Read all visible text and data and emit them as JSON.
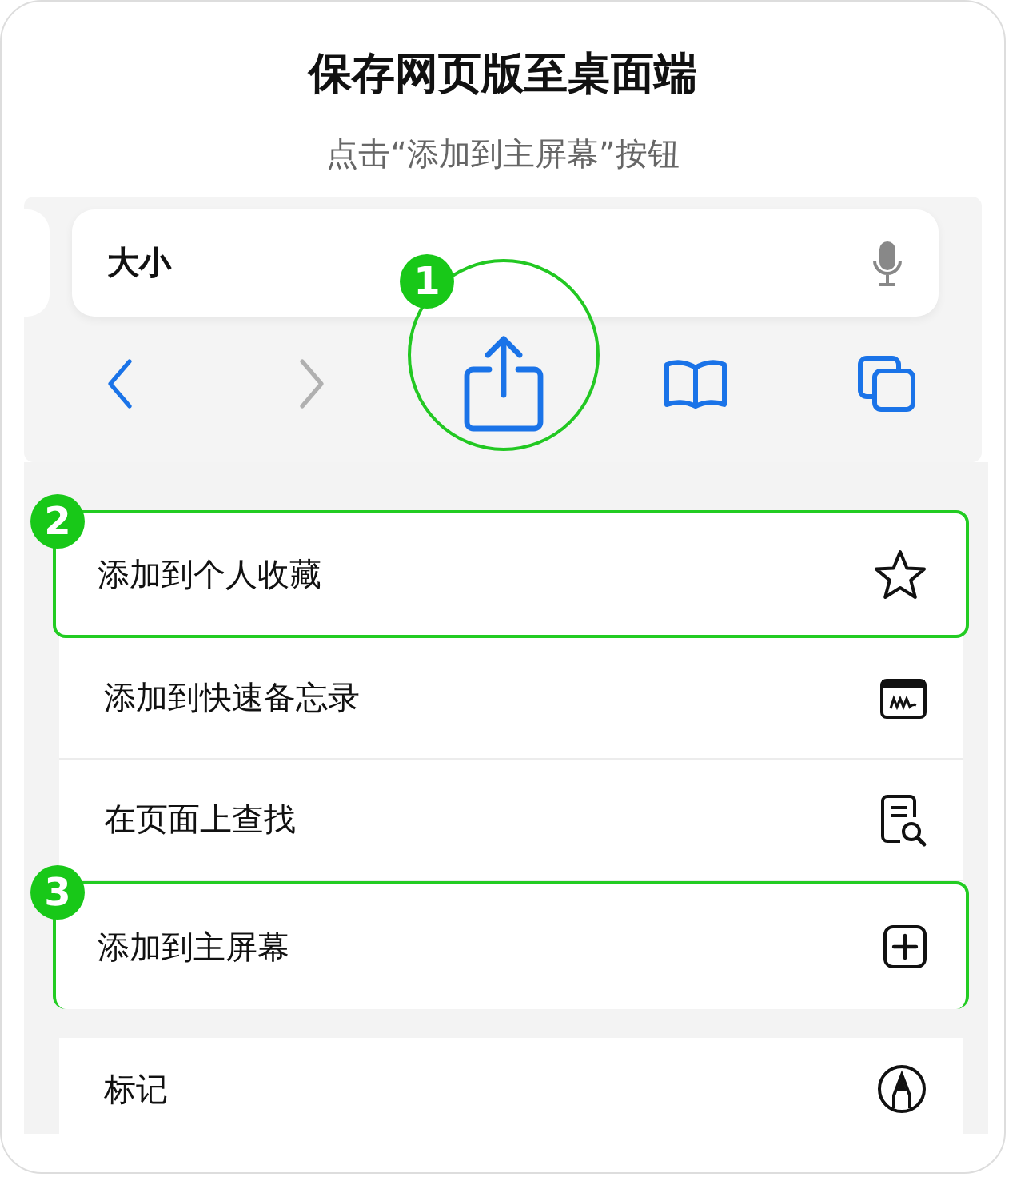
{
  "header": {
    "title": "保存网页版至桌面端",
    "subtitle": "点击“添加到主屏幕”按钮"
  },
  "browser": {
    "address": "大小",
    "toolbar": [
      {
        "kind": "back",
        "disabled": false
      },
      {
        "kind": "forward",
        "disabled": true
      },
      {
        "kind": "share",
        "disabled": false,
        "step": "1"
      },
      {
        "kind": "bookmarks",
        "disabled": false
      },
      {
        "kind": "tabs",
        "disabled": false
      }
    ]
  },
  "menu_groups": [
    {
      "items": [
        {
          "label": "添加到个人收藏",
          "kind": "star",
          "highlighted": true,
          "step": "2"
        },
        {
          "label": "添加到快速备忘录",
          "kind": "note",
          "highlighted": false
        },
        {
          "label": "在页面上查找",
          "kind": "find",
          "highlighted": false
        },
        {
          "label": "添加到主屏幕",
          "kind": "plus",
          "highlighted": true,
          "step": "3"
        }
      ]
    },
    {
      "items": [
        {
          "label": "标记",
          "kind": "markup",
          "highlighted": false
        }
      ]
    }
  ]
}
